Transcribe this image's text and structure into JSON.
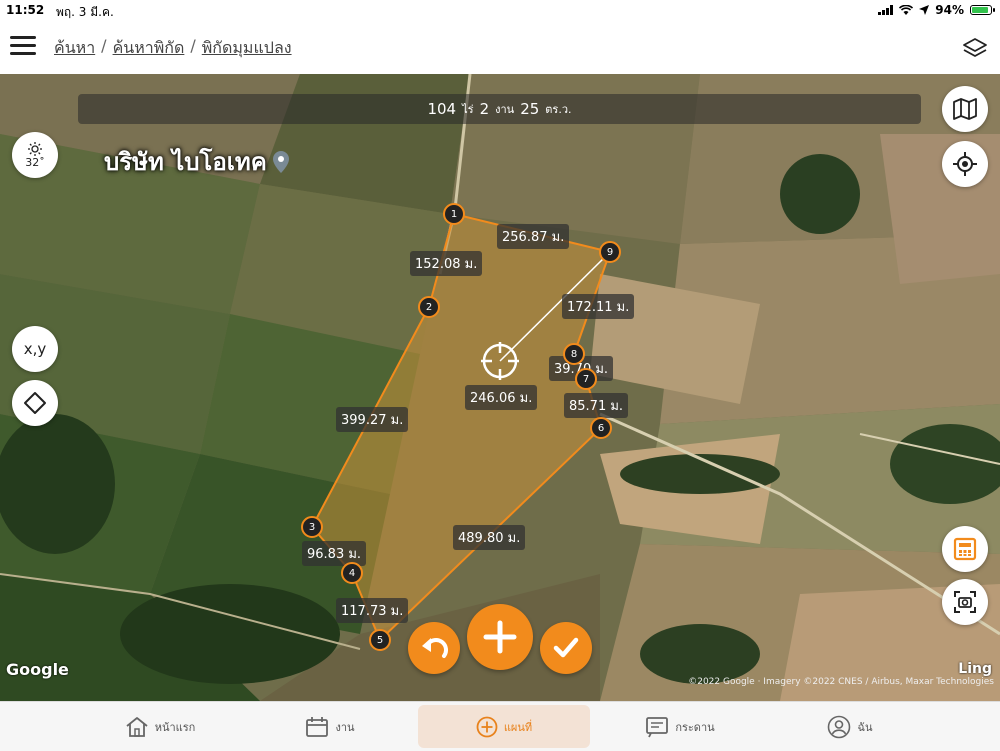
{
  "status": {
    "time": "11:52",
    "date": "พฤ. 3 มี.ค.",
    "battery": "94%"
  },
  "header": {
    "crumbs": [
      "ค้นหา",
      "ค้นหาพิกัด",
      "พิกัดมุมแปลง"
    ],
    "separator": "/"
  },
  "area": {
    "rai": "104",
    "rai_unit": "ไร่",
    "ngan": "2",
    "ngan_unit": "งาน",
    "wa": "25",
    "wa_unit": "ตร.ว."
  },
  "place_label": "บริษัท ไบโอเทค",
  "temperature": "32˚",
  "coord_button": "x,y",
  "measurements": {
    "m1": "256.87 ม.",
    "m2": "152.08 ม.",
    "m3": "172.11 ม.",
    "m4": "39.70 ม.",
    "m5": "246.06 ม.",
    "m6": "85.71 ม.",
    "m7": "399.27 ม.",
    "m8": "489.80 ม.",
    "m9": "96.83 ม.",
    "m10": "117.73 ม."
  },
  "points": [
    "1",
    "2",
    "3",
    "4",
    "5",
    "6",
    "7",
    "8",
    "9"
  ],
  "map_attribution": {
    "google": "Google",
    "ling": "Ling",
    "credit": "©2022 Google · Imagery ©2022 CNES / Airbus, Maxar Technologies"
  },
  "nav": [
    {
      "label": "หน้าแรก",
      "icon": "home-icon"
    },
    {
      "label": "งาน",
      "icon": "calendar-icon"
    },
    {
      "label": "แผนที่",
      "icon": "add-circle-icon"
    },
    {
      "label": "กระดาน",
      "icon": "board-icon"
    },
    {
      "label": "ฉัน",
      "icon": "user-icon"
    }
  ],
  "colors": {
    "accent": "#f28b1c",
    "nav_active_bg": "#f3e2d5"
  }
}
